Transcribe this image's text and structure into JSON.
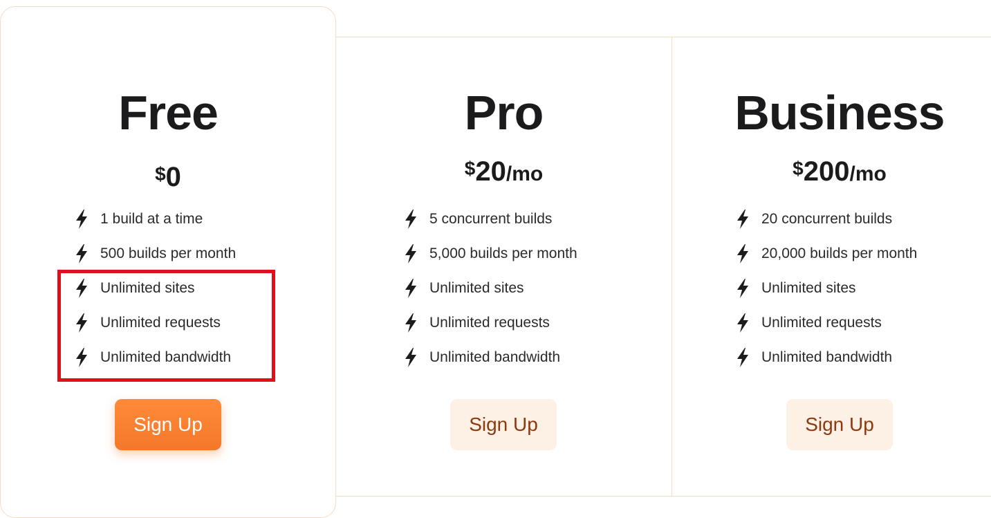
{
  "plans": [
    {
      "name": "Free",
      "currency": "$",
      "amount": "0",
      "period": "",
      "features": [
        "1 build at a time",
        "500 builds per month",
        "Unlimited sites",
        "Unlimited requests",
        "Unlimited bandwidth"
      ],
      "cta": "Sign Up"
    },
    {
      "name": "Pro",
      "currency": "$",
      "amount": "20",
      "period": "/mo",
      "features": [
        "5 concurrent builds",
        "5,000 builds per month",
        "Unlimited sites",
        "Unlimited requests",
        "Unlimited bandwidth"
      ],
      "cta": "Sign Up"
    },
    {
      "name": "Business",
      "currency": "$",
      "amount": "200",
      "period": "/mo",
      "features": [
        "20 concurrent builds",
        "20,000 builds per month",
        "Unlimited sites",
        "Unlimited requests",
        "Unlimited bandwidth"
      ],
      "cta": "Sign Up"
    }
  ],
  "icons": {
    "feature_icon": "lightning-bolt-icon"
  },
  "colors": {
    "accent_orange": "#f4782a",
    "card_border": "#f6dcc4",
    "secondary_button_bg": "#fdf0e4",
    "secondary_button_text": "#8a3a10",
    "highlight_annotation": "#e0101a"
  }
}
